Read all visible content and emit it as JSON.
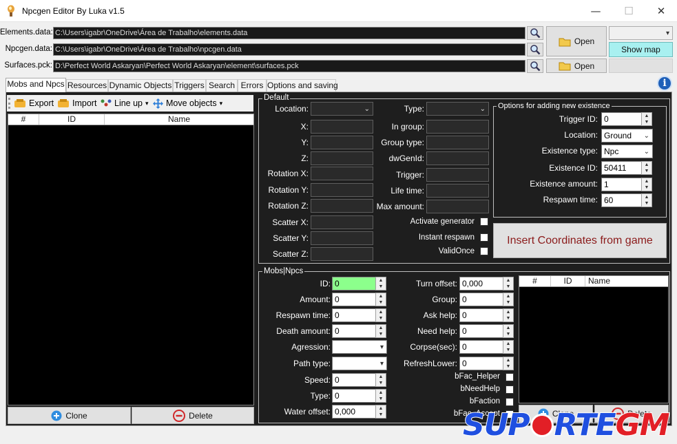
{
  "window": {
    "title": "Npcgen Editor By Luka v1.5",
    "minimize": "—",
    "maximize": "☐",
    "close": "✕"
  },
  "files": {
    "elements_label": "Elements.data:",
    "elements_path": "C:\\Users\\igabr\\OneDrive\\Área de Trabalho\\elements.data",
    "npcgen_label": "Npcgen.data:",
    "npcgen_path": "C:\\Users\\igabr\\OneDrive\\Área de Trabalho\\npcgen.data",
    "surfaces_label": "Surfaces.pck:",
    "surfaces_path": "D:\\Perfect World Askaryan\\Perfect World Askaryan\\element\\surfaces.pck",
    "open_label": "Open",
    "open2_label": "Open",
    "show_map_label": "Show map"
  },
  "tabs": [
    "Mobs and Npcs",
    "Resources",
    "Dynamic Objects",
    "Triggers",
    "Search",
    "Errors",
    "Options and saving"
  ],
  "toolbar": {
    "export": "Export",
    "import": "Import",
    "line_up": "Line up",
    "move_objects": "Move objects"
  },
  "left_grid": {
    "columns": [
      "#",
      "ID",
      "Name"
    ],
    "clone": "Clone",
    "delete": "Delete"
  },
  "default_group": {
    "title": "Default",
    "location": "Location:",
    "x": "X:",
    "y": "Y:",
    "z": "Z:",
    "rot_x": "Rotation X:",
    "rot_y": "Rotation Y:",
    "rot_z": "Rotation Z:",
    "scatter_x": "Scatter X:",
    "scatter_y": "Scatter Y:",
    "scatter_z": "Scatter Z:",
    "type": "Type:",
    "in_group": "In group:",
    "group_type": "Group type:",
    "dwgenid": "dwGenId:",
    "trigger": "Trigger:",
    "life_time": "Life time:",
    "max_amount": "Max amount:",
    "activate_generator": "Activate generator",
    "instant_respawn": "Instant respawn",
    "valid_once": "ValidOnce"
  },
  "options_group": {
    "title": "Options for adding new existence",
    "trigger_id_label": "Trigger ID:",
    "trigger_id": "0",
    "location_label": "Location:",
    "location": "Ground",
    "existence_type_label": "Existence type:",
    "existence_type": "Npc",
    "existence_id_label": "Existence ID:",
    "existence_id": "50411",
    "existence_amount_label": "Existence amount:",
    "existence_amount": "1",
    "respawn_time_label": "Respawn time:",
    "respawn_time": "60"
  },
  "insert_button": "Insert Coordinates from game",
  "mobs_group": {
    "title": "Mobs|Npcs",
    "id_label": "ID:",
    "id": "0",
    "amount_label": "Amount:",
    "amount": "0",
    "respawn_label": "Respawn time:",
    "respawn": "0",
    "death_label": "Death amount:",
    "death": "0",
    "agression_label": "Agression:",
    "path_type_label": "Path type:",
    "speed_label": "Speed:",
    "speed": "0",
    "type_label": "Type:",
    "type": "0",
    "water_label": "Water offset:",
    "water": "0,000",
    "turn_label": "Turn offset:",
    "turn": "0,000",
    "group_label": "Group:",
    "group": "0",
    "ask_help_label": "Ask help:",
    "ask_help": "0",
    "need_help_label": "Need help:",
    "need_help": "0",
    "corpse_label": "Corpse(sec):",
    "corpse": "0",
    "refresh_label": "RefreshLower:",
    "refresh": "0",
    "bfac_helper": "bFac_Helper",
    "bneedhelp": "bNeedHelp",
    "bfaction": "bFaction",
    "bfac_accept": "bFac_Accept"
  },
  "right_grid": {
    "columns": [
      "#",
      "ID",
      "Name"
    ],
    "clone": "Clone",
    "delete": "Delete"
  },
  "watermark": {
    "text_a": "SUP",
    "text_b": "RTE",
    "text_c": "GM"
  },
  "colors": {
    "panel_bg": "#1e1e1e",
    "show_map_bg": "#a8f0f0",
    "id_field_bg": "#8cff8c",
    "watermark_blue": "#1f4fe0",
    "watermark_red": "#e21f26"
  }
}
